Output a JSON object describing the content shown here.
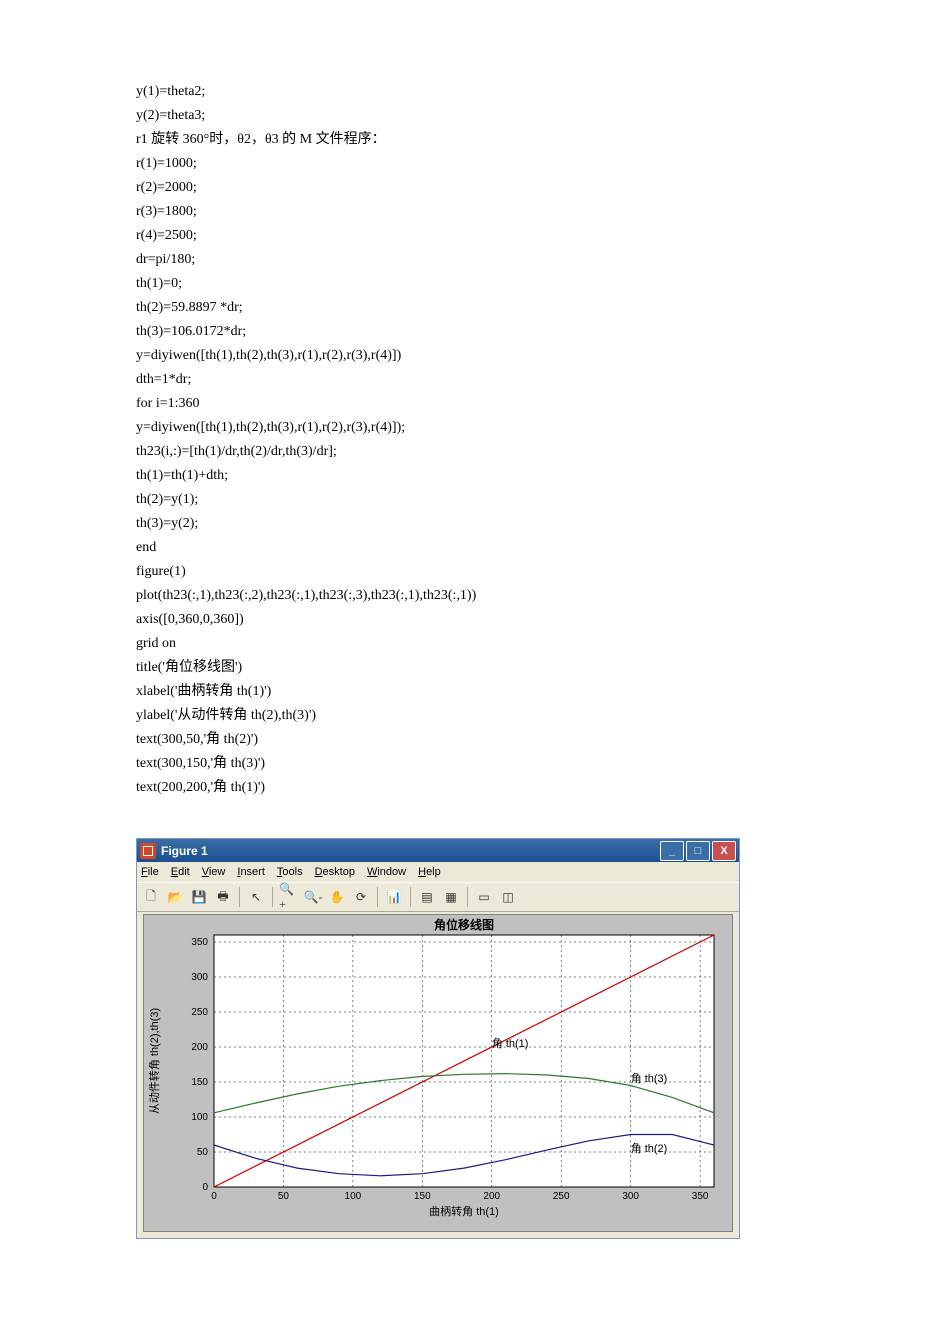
{
  "code": [
    "y(1)=theta2;",
    "y(2)=theta3;",
    "r1 旋转 360°时，θ2，θ3 的 M 文件程序：",
    "r(1)=1000;",
    "r(2)=2000;",
    "r(3)=1800;",
    "r(4)=2500;",
    "dr=pi/180;",
    "th(1)=0;",
    "th(2)=59.8897  *dr;",
    "th(3)=106.0172*dr;",
    "y=diyiwen([th(1),th(2),th(3),r(1),r(2),r(3),r(4)])",
    "dth=1*dr;",
    "for  i=1:360",
    "y=diyiwen([th(1),th(2),th(3),r(1),r(2),r(3),r(4)]);",
    "th23(i,:)=[th(1)/dr,th(2)/dr,th(3)/dr];",
    "th(1)=th(1)+dth;",
    "th(2)=y(1);",
    "th(3)=y(2);",
    "end",
    "figure(1)",
    "plot(th23(:,1),th23(:,2),th23(:,1),th23(:,3),th23(:,1),th23(:,1))",
    "axis([0,360,0,360])",
    "grid  on",
    "title('角位移线图')",
    "xlabel('曲柄转角 th(1)')",
    "ylabel('从动件转角 th(2),th(3)')",
    "text(300,50,'角 th(2)')",
    "text(300,150,'角 th(3)')",
    "text(200,200,'角 th(1)')"
  ],
  "figure": {
    "window_title": "Figure 1",
    "menu": [
      "File",
      "Edit",
      "View",
      "Insert",
      "Tools",
      "Desktop",
      "Window",
      "Help"
    ]
  },
  "chart_data": {
    "type": "line",
    "title": "角位移线图",
    "xlabel": "曲柄转角 th(1)",
    "ylabel": "从动件转角 th(2),th(3)",
    "xlim": [
      0,
      360
    ],
    "ylim": [
      0,
      360
    ],
    "xticks": [
      0,
      50,
      100,
      150,
      200,
      250,
      300,
      350
    ],
    "yticks": [
      0,
      50,
      100,
      150,
      200,
      250,
      300,
      350
    ],
    "series": [
      {
        "name": "th(1)",
        "color": "#cc0000",
        "x": [
          0,
          360
        ],
        "y": [
          0,
          360
        ]
      },
      {
        "name": "th(3)",
        "color": "#2a7a2a",
        "x": [
          0,
          30,
          60,
          90,
          120,
          150,
          180,
          210,
          240,
          270,
          300,
          330,
          360
        ],
        "y": [
          106,
          120,
          133,
          144,
          152,
          158,
          161,
          162,
          160,
          155,
          145,
          128,
          106
        ]
      },
      {
        "name": "th(2)",
        "color": "#1a1a8a",
        "x": [
          0,
          30,
          60,
          90,
          120,
          150,
          180,
          210,
          240,
          270,
          300,
          330,
          360
        ],
        "y": [
          60,
          41,
          27,
          19,
          16,
          19,
          27,
          39,
          53,
          66,
          75,
          75,
          60
        ]
      }
    ],
    "annotations": [
      {
        "text": "角 th(1)",
        "x": 200,
        "y": 200
      },
      {
        "text": "角 th(3)",
        "x": 300,
        "y": 150
      },
      {
        "text": "角 th(2)",
        "x": 300,
        "y": 50
      }
    ]
  }
}
